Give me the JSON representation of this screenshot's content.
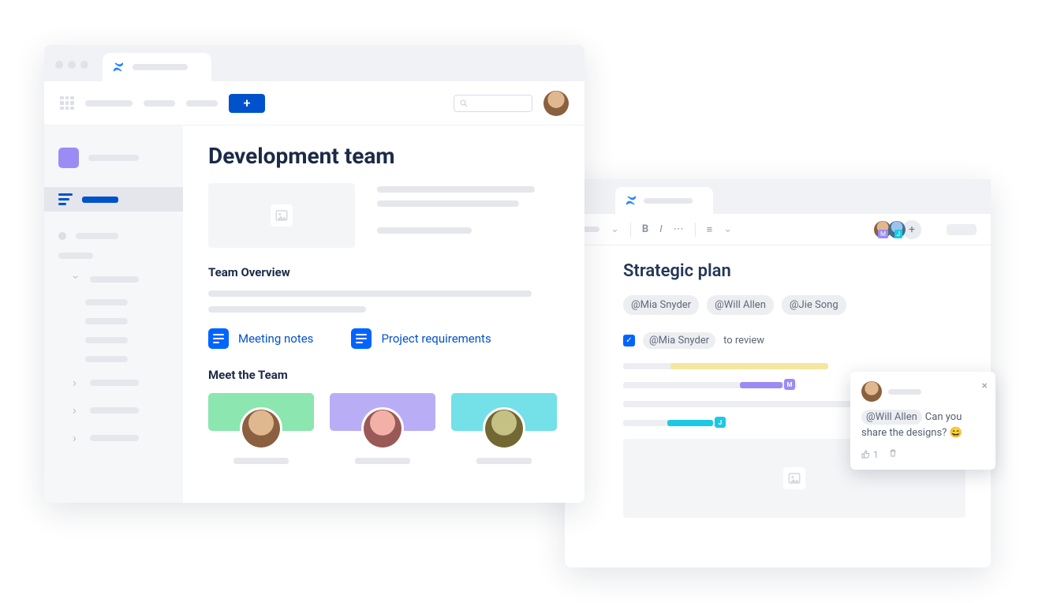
{
  "window1": {
    "title": "Development team",
    "sections": {
      "overview_heading": "Team Overview",
      "docs": [
        {
          "label": "Meeting notes"
        },
        {
          "label": "Project requirements"
        }
      ],
      "team_heading": "Meet the Team"
    },
    "team_colors": [
      "green",
      "purple",
      "cyan"
    ]
  },
  "window2": {
    "title": "Strategic plan",
    "mentions": [
      "@Mia Snyder",
      "@Will Allen",
      "@Jie Song"
    ],
    "task": {
      "checked": true,
      "mention": "@Mia Snyder",
      "text": "to review"
    },
    "highlight_badges": {
      "purple": "M",
      "cyan": "J"
    },
    "comment": {
      "mention": "@Will Allen",
      "text": "Can you share the designs? 😄",
      "like_count": "1"
    }
  }
}
